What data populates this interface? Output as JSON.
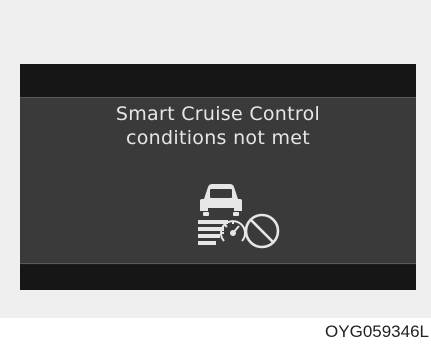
{
  "cluster_message": {
    "line1": "Smart Cruise Control",
    "line2": "conditions not met"
  },
  "icon": {
    "name": "smart-cruise-conditions-not-met-icon",
    "vehicle": "car-front-icon",
    "gauge": "speedometer-icon",
    "prohibition": "no-entry-circle-icon"
  },
  "colors": {
    "display_background": "#3a3a3a",
    "display_bars": "#161616",
    "text": "#e6e6e6",
    "page_background": "#efefef"
  },
  "figure_code": "OYG059346L"
}
